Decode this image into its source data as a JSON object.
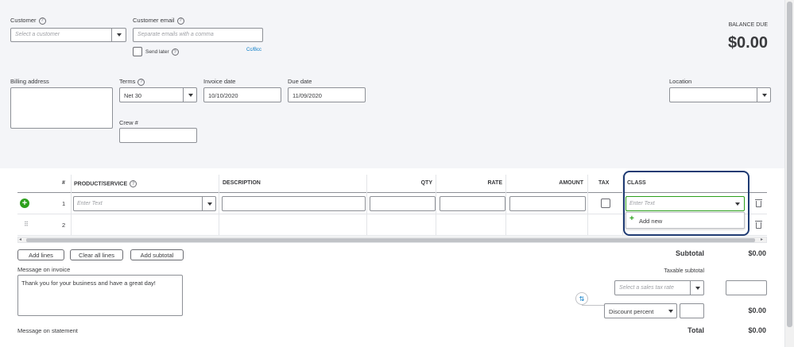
{
  "customer": {
    "label": "Customer",
    "placeholder": "Select a customer"
  },
  "customer_email": {
    "label": "Customer email",
    "placeholder": "Separate emails with a comma",
    "send_later_label": "Send later",
    "cc_bcc_label": "Cc/Bcc"
  },
  "balance": {
    "label": "BALANCE DUE",
    "amount": "$0.00"
  },
  "billing_address": {
    "label": "Billing address"
  },
  "terms": {
    "label": "Terms",
    "value": "Net 30"
  },
  "invoice_date": {
    "label": "Invoice date",
    "value": "10/10/2020"
  },
  "due_date": {
    "label": "Due date",
    "value": "11/09/2020"
  },
  "crew": {
    "label": "Crew #"
  },
  "location": {
    "label": "Location"
  },
  "table": {
    "headers": {
      "num": "#",
      "product": "PRODUCT/SERVICE",
      "description": "DESCRIPTION",
      "qty": "QTY",
      "rate": "RATE",
      "amount": "AMOUNT",
      "tax": "TAX",
      "class": "CLASS"
    },
    "rows": [
      {
        "num": "1"
      },
      {
        "num": "2"
      }
    ],
    "product_placeholder": "Enter Text",
    "class_placeholder": "Enter Text",
    "class_menu_add_new": "Add new"
  },
  "buttons": {
    "add_lines": "Add lines",
    "clear_all_lines": "Clear all lines",
    "add_subtotal": "Add subtotal"
  },
  "message_invoice": {
    "label": "Message on invoice",
    "value": "Thank you for your business and have a great day!"
  },
  "message_statement": {
    "label": "Message on statement"
  },
  "totals": {
    "subtotal_label": "Subtotal",
    "subtotal_value": "$0.00",
    "taxable_subtotal_label": "Taxable subtotal",
    "sales_tax_placeholder": "Select a sales tax rate",
    "discount_type": "Discount percent",
    "discount_amount": "$0.00",
    "total_label": "Total",
    "total_value": "$0.00"
  },
  "colors": {
    "header_bg": "#f4f5f8",
    "highlight_border": "#1f3b73",
    "focus_green": "#2ca01c",
    "link_blue": "#0077c5"
  }
}
